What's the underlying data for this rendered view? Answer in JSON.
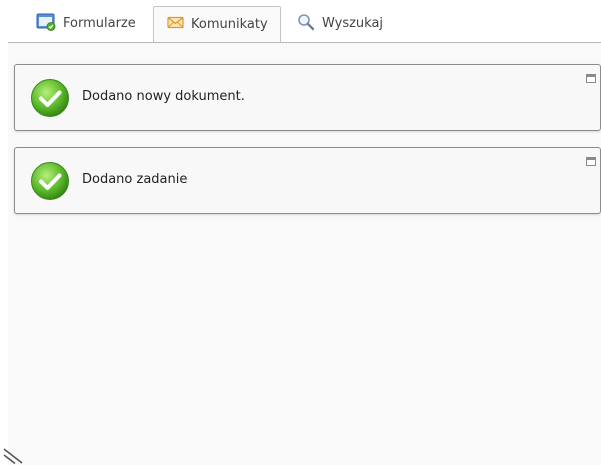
{
  "tabs": [
    {
      "label": "Formularze",
      "icon": "forms-icon"
    },
    {
      "label": "Komunikaty",
      "icon": "envelope-icon",
      "active": true
    },
    {
      "label": "Wyszukaj",
      "icon": "search-icon"
    }
  ],
  "messages": [
    {
      "text": "Dodano nowy dokument.",
      "status": "success"
    },
    {
      "text": "Dodano zadanie",
      "status": "success"
    }
  ],
  "colors": {
    "success_green": "#5bb82a",
    "border": "#8c8c8c",
    "envelope": "#e8a33a"
  }
}
